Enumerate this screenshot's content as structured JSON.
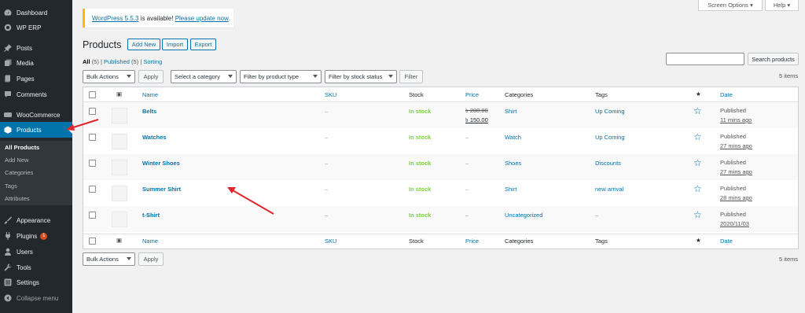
{
  "sidebar": {
    "items": [
      {
        "label": "Dashboard",
        "icon": "dashboard-icon"
      },
      {
        "label": "WP ERP",
        "icon": "erp-icon"
      },
      {
        "label": "Posts",
        "icon": "pin-icon"
      },
      {
        "label": "Media",
        "icon": "media-icon"
      },
      {
        "label": "Pages",
        "icon": "pages-icon"
      },
      {
        "label": "Comments",
        "icon": "comment-icon"
      },
      {
        "label": "WooCommerce",
        "icon": "woo-icon"
      },
      {
        "label": "Products",
        "icon": "box-icon"
      },
      {
        "label": "Appearance",
        "icon": "brush-icon"
      },
      {
        "label": "Plugins",
        "icon": "plug-icon",
        "badge": "1"
      },
      {
        "label": "Users",
        "icon": "user-icon"
      },
      {
        "label": "Tools",
        "icon": "wrench-icon"
      },
      {
        "label": "Settings",
        "icon": "settings-icon"
      },
      {
        "label": "Collapse menu",
        "icon": "collapse-icon"
      }
    ],
    "submenu": [
      "All Products",
      "Add New",
      "Categories",
      "Tags",
      "Attributes"
    ]
  },
  "screen_tabs": {
    "screen_options": "Screen Options",
    "help": "Help"
  },
  "notice": {
    "version_link": "WordPress 5.5.3",
    "middle": " is available! ",
    "update_link": "Please update now",
    "end": "."
  },
  "page": {
    "title": "Products",
    "add_new": "Add New",
    "import": "Import",
    "export": "Export"
  },
  "views": {
    "all": "All",
    "all_count": "(5)",
    "sep": "|",
    "published": "Published",
    "published_count": "(5)",
    "sorting": "Sorting"
  },
  "search": {
    "button": "Search products",
    "placeholder": ""
  },
  "filters": {
    "bulk_actions": "Bulk Actions",
    "apply": "Apply",
    "category": "Select a category",
    "product_type": "Filter by product type",
    "stock_status": "Filter by stock status",
    "filter": "Filter",
    "items_count": "5 items"
  },
  "table": {
    "columns": [
      "Name",
      "SKU",
      "Stock",
      "Price",
      "Categories",
      "Tags",
      "Date"
    ],
    "rows": [
      {
        "name": "Belts",
        "sku": "–",
        "stock": "In stock",
        "price_old": "৳ 200.00",
        "price_new": "৳ 150.00",
        "category": "Shirt",
        "tags": "Up Coming",
        "status": "Published",
        "date": "11 mins ago"
      },
      {
        "name": "Watches",
        "sku": "–",
        "stock": "In stock",
        "price": "–",
        "category": "Watch",
        "tags": "Up Coming",
        "status": "Published",
        "date": "27 mins ago"
      },
      {
        "name": "Winter Shoes",
        "sku": "–",
        "stock": "In stock",
        "price": "–",
        "category": "Shoes",
        "tags": "Discounts",
        "status": "Published",
        "date": "27 mins ago"
      },
      {
        "name": "Summer Shirt",
        "sku": "–",
        "stock": "In stock",
        "price": "–",
        "category": "Shirt",
        "tags": "new arrival",
        "status": "Published",
        "date": "28 mins ago"
      },
      {
        "name": "t-Shirt",
        "sku": "–",
        "stock": "In stock",
        "price": "–",
        "category": "Uncategorized",
        "tags": "–",
        "status": "Published",
        "date": "2020/11/03"
      }
    ]
  },
  "bottom": {
    "bulk_actions": "Bulk Actions",
    "apply": "Apply",
    "items_count": "5 items"
  },
  "colors": {
    "sidebar": "#23282d",
    "active": "#0073aa",
    "link": "#0073aa",
    "in_stock": "#7ad03a",
    "arrow": "#e0262d"
  }
}
